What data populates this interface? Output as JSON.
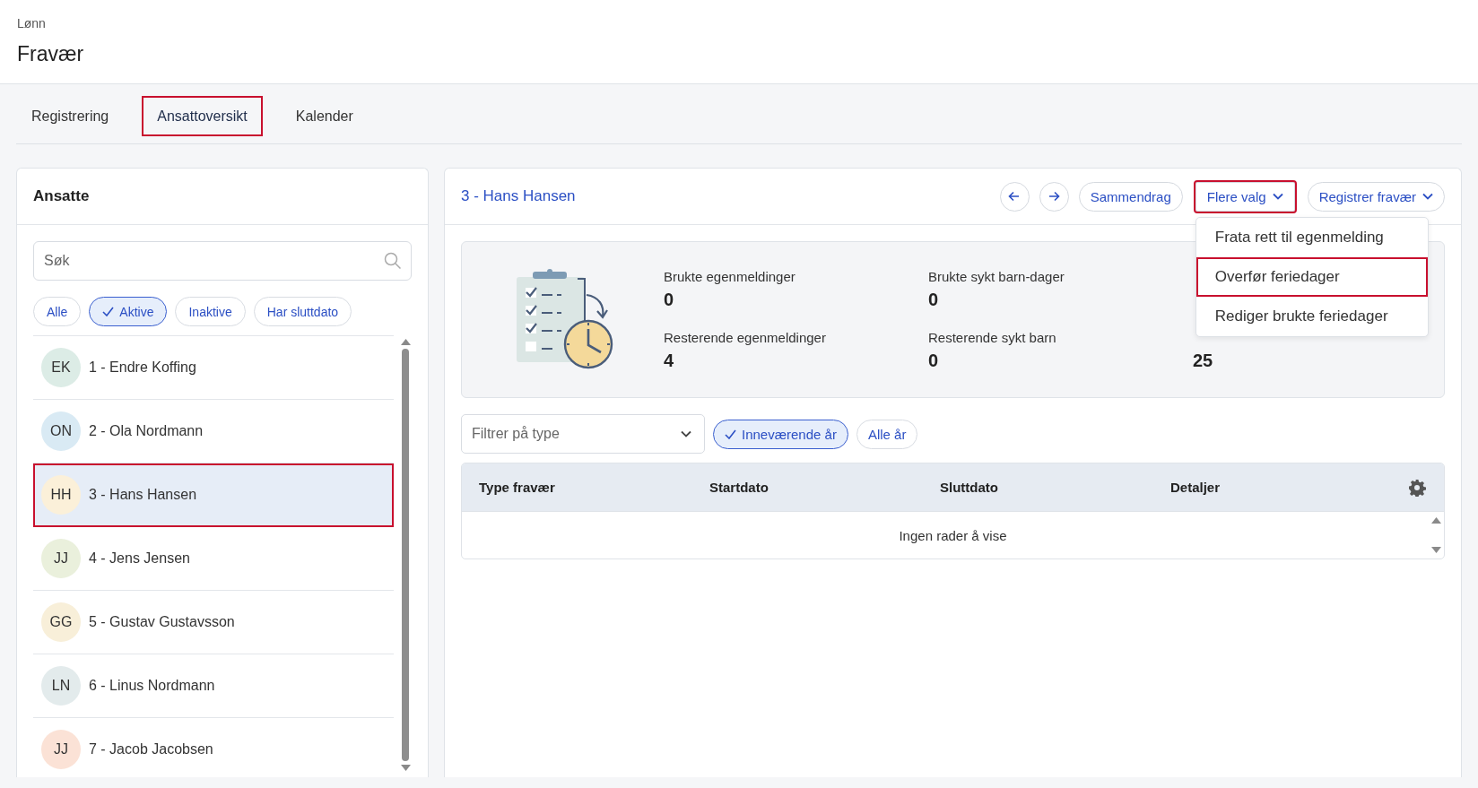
{
  "breadcrumb": "Lønn",
  "title": "Fravær",
  "tabs": [
    {
      "label": "Registrering",
      "selected": false,
      "highlighted": false
    },
    {
      "label": "Ansattoversikt",
      "selected": true,
      "highlighted": true
    },
    {
      "label": "Kalender",
      "selected": false,
      "highlighted": false
    }
  ],
  "employees_panel": {
    "title": "Ansatte",
    "search": {
      "placeholder": "Søk"
    },
    "filters": [
      {
        "label": "Alle",
        "selected": false
      },
      {
        "label": "Aktive",
        "selected": true
      },
      {
        "label": "Inaktive",
        "selected": false
      },
      {
        "label": "Har sluttdato",
        "selected": false
      }
    ],
    "employees": [
      {
        "initials": "EK",
        "name": "1 - Endre Koffing",
        "color": "#dcece6",
        "selected": false,
        "highlighted": false
      },
      {
        "initials": "ON",
        "name": "2 - Ola Nordmann",
        "color": "#d9eaf4",
        "selected": false,
        "highlighted": false
      },
      {
        "initials": "HH",
        "name": "3 - Hans Hansen",
        "color": "#fbf0d9",
        "selected": true,
        "highlighted": true
      },
      {
        "initials": "JJ",
        "name": "4 - Jens Jensen",
        "color": "#eaf0dc",
        "selected": false,
        "highlighted": false
      },
      {
        "initials": "GG",
        "name": "5 - Gustav Gustavsson",
        "color": "#f8efd9",
        "selected": false,
        "highlighted": false
      },
      {
        "initials": "LN",
        "name": "6 - Linus Nordmann",
        "color": "#e3ebec",
        "selected": false,
        "highlighted": false
      },
      {
        "initials": "JJ",
        "name": "7 - Jacob Jacobsen",
        "color": "#fbe2d6",
        "selected": false,
        "highlighted": false
      }
    ]
  },
  "detail": {
    "title": "3 - Hans Hansen",
    "buttons": [
      {
        "kind": "previous"
      },
      {
        "kind": "next"
      },
      {
        "kind": "text",
        "label": "Sammendrag",
        "highlighted": false
      },
      {
        "kind": "dropdown",
        "label": "Flere valg",
        "highlighted": true,
        "menu": [
          {
            "label": "Frata rett til egenmelding",
            "highlighted": false
          },
          {
            "label": "Overfør feriedager",
            "highlighted": true
          },
          {
            "label": "Rediger brukte feriedager",
            "highlighted": false
          }
        ]
      },
      {
        "kind": "dropdown",
        "label": "Registrer fravær",
        "highlighted": false
      }
    ],
    "stat_rows": [
      [
        {
          "label": "Brukte egenmeldinger",
          "value": "0"
        },
        {
          "label": "Brukte sykt barn-dager",
          "value": "0"
        }
      ],
      [
        {
          "label": "Resterende egenmeldinger",
          "value": "4"
        },
        {
          "label": "Resterende sykt barn",
          "value": "0"
        },
        {
          "value": "25"
        }
      ]
    ],
    "type_filter": {
      "placeholder": "Filtrer på type"
    },
    "year_filters": [
      {
        "label": "Inneværende år",
        "selected": true
      },
      {
        "label": "Alle år",
        "selected": false
      }
    ],
    "table": {
      "columns": [
        "Type fravær",
        "Startdato",
        "Sluttdato",
        "Detaljer"
      ],
      "empty_text": "Ingen rader å vise"
    }
  }
}
